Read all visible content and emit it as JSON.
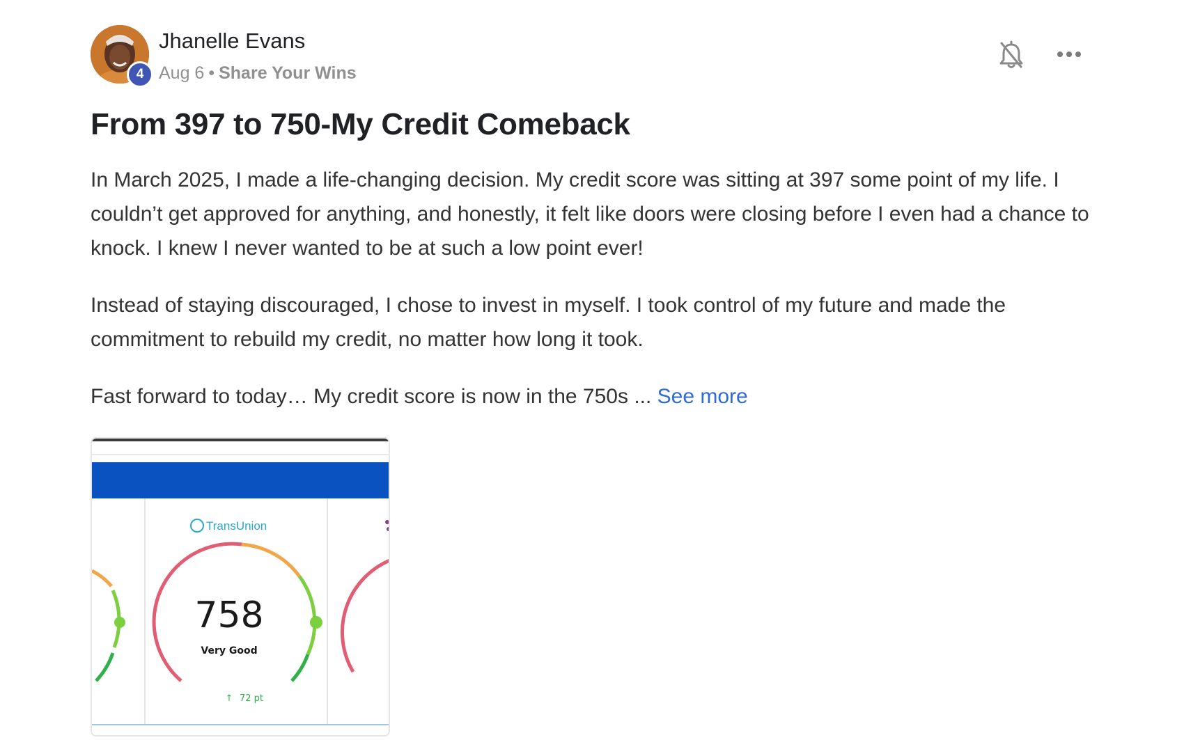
{
  "post": {
    "author": "Jhanelle Evans",
    "level": "4",
    "date": "Aug 6",
    "separator": "•",
    "category": "Share Your Wins",
    "title": "From 397 to 750-My Credit Comeback",
    "paragraphs": [
      "In March 2025, I made a life-changing decision. My credit score was sitting at 397 some point of my life. I couldn’t get approved for anything, and honestly, it felt like doors were closing before I even had a chance to knock. I knew I never wanted to be at such a low point ever!",
      "Instead of staying discouraged, I chose to invest in myself. I took control of my future and made the commitment to rebuild my credit, no matter how long it took."
    ],
    "last_paragraph": "Fast forward to today… My credit score is now in the 750s ...",
    "see_more_label": "See more"
  },
  "icons": {
    "notifications": "bell-off-icon",
    "more": "more-horizontal-icon"
  },
  "attachment": {
    "bureau": "TransUnion",
    "score": "758",
    "rating": "Very Good",
    "change": "72 pt",
    "colors": {
      "header_bar": "#0a52c0",
      "gauge_red": "#e15d73",
      "gauge_orange": "#f0a64a",
      "gauge_green": "#7ccf3e"
    }
  }
}
